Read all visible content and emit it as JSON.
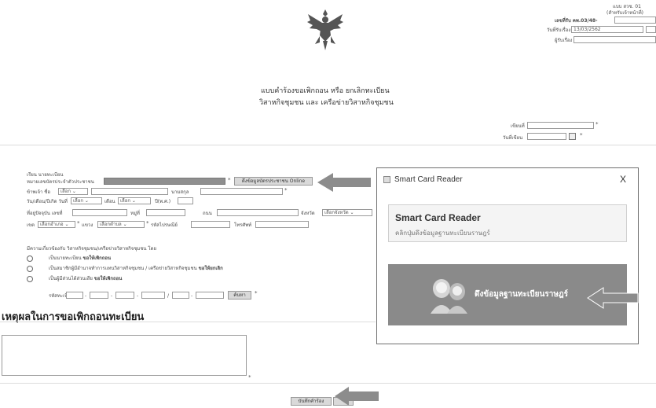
{
  "header": {
    "emblem": "garuda-emblem",
    "form_code_line1": "แบบ สวช. 01",
    "form_code_line2": "(สำหรับเจ้าหน้าที่)",
    "form_no_label": "เลขที่รับ คพ.03/48-",
    "received_date_label": "วันที่รับเรื่อง",
    "received_date_value": "13/03/2562",
    "receiver_label": "ผู้รับเรื่อง"
  },
  "title": {
    "line1": "แบบคำร้องขอเพิกถอน หรือ ยกเลิกทะเบียน",
    "line2": "วิสาหกิจชุมชน และ เครือข่ายวิสาหกิจชุมชน"
  },
  "meta": {
    "written_at_label": "เขียนที่",
    "date_label": "วันที่เขียน"
  },
  "applicant": {
    "to_label": "เรียน นายทะเบียน",
    "id_label": "หมายเลขบัตรประจำตัวประชาชน",
    "fetch_online_button": "ดึงข้อมูลบัตรประชาชน Online",
    "prefix_label": "ข้าพเจ้า ชื่อ",
    "prefix_value": "เลือก",
    "surname_label": "นามสกุล",
    "birth_label": "วัน/เดือน/ปีเกิด วันที่",
    "day_value": "เลือก",
    "month_label": "เดือน",
    "month_value": "เลือก",
    "year_label": "ปี(พ.ศ.)",
    "address_label": "ที่อยู่ปัจจุบัน เลขที่",
    "moo_label": "หมู่ที่",
    "soi_label": "ถนน",
    "province_label": "จังหวัด",
    "province_value": "เลือกจังหวัด",
    "district_label": "เขต",
    "district_value": "เลือกอำเภอ",
    "subdistrict_label": "แขวง",
    "subdistrict_value": "เลือกตำบล",
    "postcode_label": "รหัสไปรษณีย์",
    "phone_label": "โทรศัพท์"
  },
  "relation": {
    "question": "มีความเกี่ยวข้องกับ วิสาหกิจชุมชน/เครือข่ายวิสาหกิจชุมชน โดย",
    "options": [
      {
        "text": "เป็นนายทะเบียน",
        "action": "ขอให้เพิกถอน"
      },
      {
        "text": "เป็นสมาชิกผู้มีอำนาจทำการแทนวิสาหกิจชุมชน / เครือข่ายวิสาหกิจชุมชน",
        "action": "ขอให้ยกเลิก"
      },
      {
        "text": "เป็นผู้มีส่วนได้ส่วนเสีย",
        "action": "ขอให้เพิกถอน"
      }
    ],
    "reg_code_label": "รหัสทะเบียน",
    "search_button": "ค้นหา"
  },
  "reason": {
    "heading": "เหตุผลในการขอเพิกถอนทะเบียน"
  },
  "footer": {
    "save_button": "บันทึกคำร้อง"
  },
  "popup": {
    "window_title": "Smart Card Reader",
    "close_glyph": "X",
    "panel_title": "Smart Card Reader",
    "panel_hint": "คลิกปุ่มดึงข้อมูลฐานทะเบียนราษฎร์",
    "action_button": "ดึงข้อมูลฐานทะเบียนราษฎร์"
  },
  "required_mark": "*",
  "colors": {
    "arrow_fill": "#8c8c8c",
    "popup_button_bg": "#8a8a8a",
    "panel_bg": "#f4f4f4"
  }
}
